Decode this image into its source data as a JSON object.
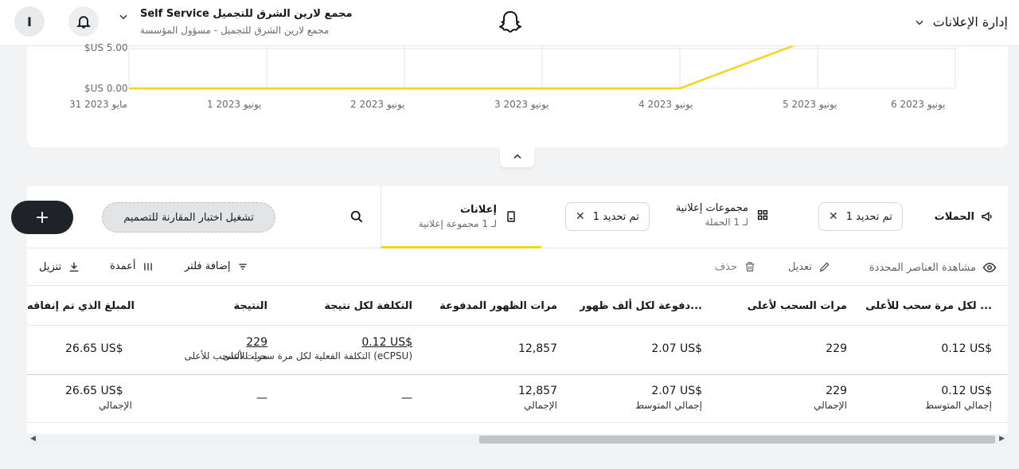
{
  "header": {
    "avatar_initial": "I",
    "org_name": "مجمع لارين الشرق للتجميل Self Service",
    "org_sub": "مجمع لارين الشرق للتجميل - مسؤول المؤسسة",
    "ads_manager_label": "إدارة الإعلانات"
  },
  "chart_data": {
    "type": "line",
    "yticks": [
      "$US 5.00",
      "$US 0.00"
    ],
    "x": [
      "31 مايو 2023",
      "1 يونيو 2023",
      "2 يونيو 2023",
      "3 يونيو 2023",
      "4 يونيو 2023",
      "5 يونيو 2023",
      "6 يونيو 2023"
    ],
    "series": [
      {
        "values": [
          0,
          0,
          0,
          0,
          0,
          6.5,
          null
        ]
      }
    ],
    "ylim": [
      0,
      5.5
    ],
    "grid": true,
    "line_color": "#f7d417"
  },
  "tabs": {
    "campaigns_label": "الحملات",
    "campaigns_chip": "تم تحديد 1",
    "adsets_label": "مجموعات إعلانية",
    "adsets_sub": "لـ 1 الحملة",
    "adsets_chip": "تم تحديد 1",
    "ads_label": "إعلانات",
    "ads_sub": "لـ 1 مجموعة إعلانية",
    "ab_test_label": "تشغيل اختبار المقارنة للتصميم",
    "add_label": "+"
  },
  "toolbar": {
    "view_selected": "مشاهدة العناصر المحددة",
    "edit": "تعديل",
    "delete": "حذف",
    "add_filter": "إضافة فلتر",
    "columns": "أعمدة",
    "download": "تنزيل"
  },
  "table": {
    "headers": [
      "... لكل مرة سحب للأعلى",
      "مرات السحب لأعلى",
      "...دفوعة لكل ألف ظهور",
      "مرات الظهور المدفوعة",
      "التكلفة لكل نتيجة",
      "النتيجة",
      "المبلغ الذي تم إنفاقه"
    ],
    "row1": {
      "cpsu": "0.12 US$",
      "swipes": "229",
      "ecpm": "2.07 US$",
      "impressions": "12,857",
      "cost_per_result": "0.12 US$",
      "cost_per_result_sub": "(eCPSU) التكلفة الفعلية لكل مرة سحب للأعلى",
      "result": "229",
      "result_sub": "مرات السحب للأعلى",
      "spend": "26.65 US$"
    },
    "totals": {
      "cpsu": "0.12 US$",
      "cpsu_lbl": "إجمالي المتوسط",
      "swipes": "229",
      "swipes_lbl": "الإجمالي",
      "ecpm": "2.07 US$",
      "ecpm_lbl": "إجمالي المتوسط",
      "impressions": "12,857",
      "impressions_lbl": "الإجمالي",
      "cost_per_result": "—",
      "result": "—",
      "spend": "26.65 US$",
      "spend_lbl": "الإجمالي"
    }
  }
}
